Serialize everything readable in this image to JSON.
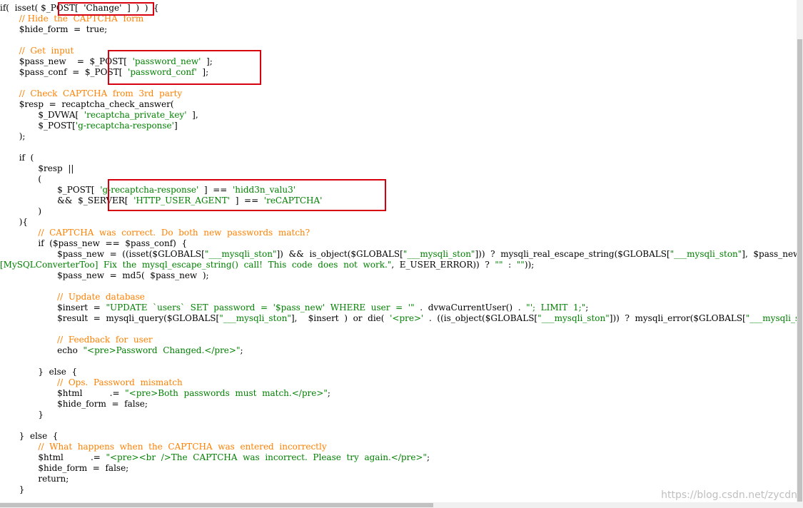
{
  "colors": {
    "default": "#000000",
    "comment": "#ff8000",
    "string": "#008000",
    "highlight_box": "#d7000f"
  },
  "watermark": "https://blog.csdn.net/zycdn",
  "code_lines": [
    [
      {
        "t": "if(  isset( ",
        "c": "d"
      },
      {
        "t": "$_POST[  'Change'  ]",
        "c": "d"
      },
      {
        "t": "  )  )  {",
        "c": "d"
      }
    ],
    [
      {
        "t": "       // Hide  the  CAPTCHA  form",
        "c": "c"
      }
    ],
    [
      {
        "t": "       $hide_form  =  true;",
        "c": "d"
      }
    ],
    [
      {
        "t": "",
        "c": "d"
      }
    ],
    [
      {
        "t": "       //  Get  input",
        "c": "c"
      }
    ],
    [
      {
        "t": "       $pass_new    =  ",
        "c": "d"
      },
      {
        "t": "$_POST[  ",
        "c": "d"
      },
      {
        "t": "'password_new'",
        "c": "s"
      },
      {
        "t": "  ];",
        "c": "d"
      }
    ],
    [
      {
        "t": "       $pass_conf  =  ",
        "c": "d"
      },
      {
        "t": "$_POST[  ",
        "c": "d"
      },
      {
        "t": "'password_conf'",
        "c": "s"
      },
      {
        "t": "  ];",
        "c": "d"
      }
    ],
    [
      {
        "t": "",
        "c": "d"
      }
    ],
    [
      {
        "t": "       //  Check  CAPTCHA  from  3rd  party",
        "c": "c"
      }
    ],
    [
      {
        "t": "       $resp  =  recaptcha_check_answer(",
        "c": "d"
      }
    ],
    [
      {
        "t": "              $_DVWA[  ",
        "c": "d"
      },
      {
        "t": "'recaptcha_private_key'",
        "c": "s"
      },
      {
        "t": "  ],",
        "c": "d"
      }
    ],
    [
      {
        "t": "              $_POST[",
        "c": "d"
      },
      {
        "t": "'g-recaptcha-response'",
        "c": "s"
      },
      {
        "t": "]",
        "c": "d"
      }
    ],
    [
      {
        "t": "       );",
        "c": "d"
      }
    ],
    [
      {
        "t": "",
        "c": "d"
      }
    ],
    [
      {
        "t": "       if  (",
        "c": "d"
      }
    ],
    [
      {
        "t": "              $resp  ||",
        "c": "d"
      }
    ],
    [
      {
        "t": "              (",
        "c": "d"
      }
    ],
    [
      {
        "t": "                     $_POST[  ",
        "c": "d"
      },
      {
        "t": "'g-recaptcha-response'",
        "c": "s"
      },
      {
        "t": "  ]  ==  ",
        "c": "d"
      },
      {
        "t": "'hidd3n_valu3'",
        "c": "s"
      }
    ],
    [
      {
        "t": "                     &&  $_SERVER[  ",
        "c": "d"
      },
      {
        "t": "'HTTP_USER_AGENT'",
        "c": "s"
      },
      {
        "t": "  ]  ==  ",
        "c": "d"
      },
      {
        "t": "'reCAPTCHA'",
        "c": "s"
      }
    ],
    [
      {
        "t": "              )",
        "c": "d"
      }
    ],
    [
      {
        "t": "       ){",
        "c": "d"
      }
    ],
    [
      {
        "t": "              //  CAPTCHA  was  correct.  Do  both  new  passwords  match?",
        "c": "c"
      }
    ],
    [
      {
        "t": "              if  ($pass_new  ==  $pass_conf)  {",
        "c": "d"
      }
    ],
    [
      {
        "t": "                     $pass_new  =  ((isset($GLOBALS[",
        "c": "d"
      },
      {
        "t": "\"___mysqli_ston\"",
        "c": "s"
      },
      {
        "t": "])  &&  is_object($GLOBALS[",
        "c": "d"
      },
      {
        "t": "\"___mysqli_ston\"",
        "c": "s"
      },
      {
        "t": "]))  ?  mysqli_real_escape_string($GLOBALS[",
        "c": "d"
      },
      {
        "t": "\"___mysqli_ston\"",
        "c": "s"
      },
      {
        "t": "],  $pass_new)  :",
        "c": "d"
      }
    ],
    [
      {
        "t": "[MySQLConverterToo]  Fix  the  mysql_escape_string()  call!  This  code  does  not  work.\"",
        "c": "s"
      },
      {
        "t": ",  E_USER_ERROR))  ?  ",
        "c": "d"
      },
      {
        "t": "\"\"",
        "c": "s"
      },
      {
        "t": "  :  ",
        "c": "d"
      },
      {
        "t": "\"\"",
        "c": "s"
      },
      {
        "t": "));",
        "c": "d"
      }
    ],
    [
      {
        "t": "                     $pass_new  =  md5(  $pass_new  );",
        "c": "d"
      }
    ],
    [
      {
        "t": "",
        "c": "d"
      }
    ],
    [
      {
        "t": "                     //  Update  database",
        "c": "c"
      }
    ],
    [
      {
        "t": "                     $insert  =  ",
        "c": "d"
      },
      {
        "t": "\"UPDATE  `users`  SET  password  =  '$pass_new'  WHERE  user  =  '\"",
        "c": "s"
      },
      {
        "t": "  .  dvwaCurrentUser()  .  ",
        "c": "d"
      },
      {
        "t": "\"';  LIMIT  1;\"",
        "c": "s"
      },
      {
        "t": ";",
        "c": "d"
      }
    ],
    [
      {
        "t": "                     $result  =  mysqli_query($GLOBALS[",
        "c": "d"
      },
      {
        "t": "\"___mysqli_ston\"",
        "c": "s"
      },
      {
        "t": "],    $insert  )  or  die(  ",
        "c": "d"
      },
      {
        "t": "'<pre>'",
        "c": "s"
      },
      {
        "t": "  .  ((is_object($GLOBALS[",
        "c": "d"
      },
      {
        "t": "\"___mysqli_ston\"",
        "c": "s"
      },
      {
        "t": "]))  ?  mysqli_error($GLOBALS[",
        "c": "d"
      },
      {
        "t": "\"___mysqli_ston\"",
        "c": "s"
      },
      {
        "t": "])",
        "c": "d"
      }
    ],
    [
      {
        "t": "",
        "c": "d"
      }
    ],
    [
      {
        "t": "                     //  Feedback  for  user",
        "c": "c"
      }
    ],
    [
      {
        "t": "                     echo  ",
        "c": "d"
      },
      {
        "t": "\"<pre>Password  Changed.</pre>\"",
        "c": "s"
      },
      {
        "t": ";",
        "c": "d"
      }
    ],
    [
      {
        "t": "",
        "c": "d"
      }
    ],
    [
      {
        "t": "              }  else  {",
        "c": "d"
      }
    ],
    [
      {
        "t": "                     //  Ops.  Password  mismatch",
        "c": "c"
      }
    ],
    [
      {
        "t": "                     $html          .=  ",
        "c": "d"
      },
      {
        "t": "\"<pre>Both  passwords  must  match.</pre>\"",
        "c": "s"
      },
      {
        "t": ";",
        "c": "d"
      }
    ],
    [
      {
        "t": "                     $hide_form  =  false;",
        "c": "d"
      }
    ],
    [
      {
        "t": "              }",
        "c": "d"
      }
    ],
    [
      {
        "t": "",
        "c": "d"
      }
    ],
    [
      {
        "t": "       }  else  {",
        "c": "d"
      }
    ],
    [
      {
        "t": "              //  What  happens  when  the  CAPTCHA  was  entered  incorrectly",
        "c": "c"
      }
    ],
    [
      {
        "t": "              $html          .=  ",
        "c": "d"
      },
      {
        "t": "\"<pre><br  />The  CAPTCHA  was  incorrect.  Please  try  again.</pre>\"",
        "c": "s"
      },
      {
        "t": ";",
        "c": "d"
      }
    ],
    [
      {
        "t": "              $hide_form  =  false;",
        "c": "d"
      }
    ],
    [
      {
        "t": "              return;",
        "c": "d"
      }
    ],
    [
      {
        "t": "       }",
        "c": "d"
      }
    ]
  ]
}
